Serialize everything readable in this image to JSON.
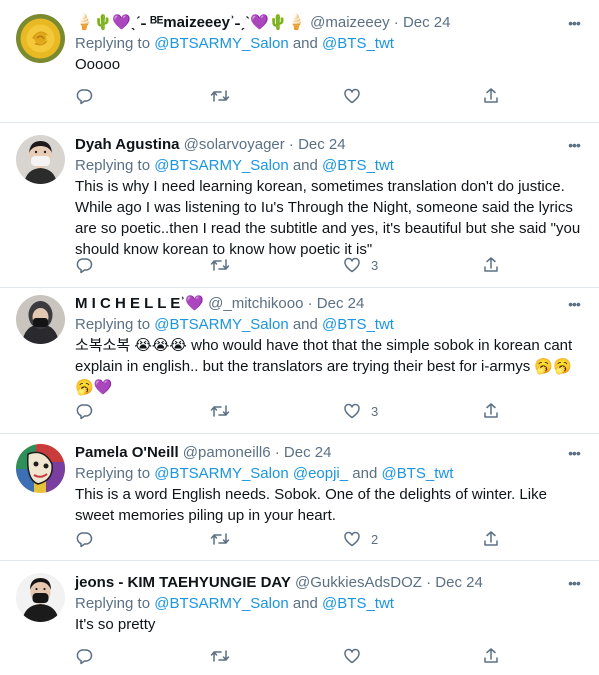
{
  "tweets": [
    {
      "name": "🍦🌵💜ˎˊ˗ ᴮᴱmaizeeeyʾ˗ˏˋ💜🌵🍦",
      "handle": "@maizeeey",
      "dot": "·",
      "date": "Dec 24",
      "replying_prefix": "Replying to",
      "mentions": [
        "@BTSARMY_Salon",
        "@BTS_twt"
      ],
      "joiner": "and",
      "text": "Ooooo",
      "reply_count": "",
      "retweet_count": "",
      "like_count": "",
      "avatar": "yellow-rose"
    },
    {
      "name": "Dyah Agustina",
      "handle": "@solarvoyager",
      "dot": "·",
      "date": "Dec 24",
      "replying_prefix": "Replying to",
      "mentions": [
        "@BTSARMY_Salon",
        "@BTS_twt"
      ],
      "joiner": "and",
      "text": "This is why I need learning korean, sometimes translation don't do justice. While ago I was listening to Iu's Through the Night, someone said the lyrics are so poetic..then I read the subtitle and yes, it's beautiful but she said \"you should know korean to know how poetic it is\"",
      "reply_count": "",
      "retweet_count": "",
      "like_count": "3",
      "avatar": "masked-woman"
    },
    {
      "name": "M I C H E L L Eʾ💜",
      "handle": "@_mitchikooo",
      "dot": "·",
      "date": "Dec 24",
      "replying_prefix": "Replying to",
      "mentions": [
        "@BTSARMY_Salon",
        "@BTS_twt"
      ],
      "joiner": "and",
      "text": "소복소복 😭😭😭  who would have thot that the simple sobok in korean cant explain in english.. but the translators are trying their best for i-armys 🥱🥱🥱💜",
      "reply_count": "",
      "retweet_count": "",
      "like_count": "3",
      "avatar": "masked-person"
    },
    {
      "name": "Pamela O'Neill",
      "handle": "@pamoneill6",
      "dot": "·",
      "date": "Dec 24",
      "replying_prefix": "Replying to",
      "mentions": [
        "@BTSARMY_Salon",
        "@eopji_",
        "@BTS_twt"
      ],
      "joiner": "and",
      "text": "This is a word English needs. Sobok. One of the delights of winter. Like sweet memories piling up in your heart.",
      "reply_count": "",
      "retweet_count": "",
      "like_count": "2",
      "avatar": "abstract-art"
    },
    {
      "name": "jeons - KIM TAEHYUNGIE DAY",
      "handle": "@GukkiesAdsDOZ",
      "dot": "·",
      "date": "Dec 24",
      "replying_prefix": "Replying to",
      "mentions": [
        "@BTSARMY_Salon",
        "@BTS_twt"
      ],
      "joiner": "and",
      "text": "It's so pretty",
      "reply_count": "",
      "retweet_count": "",
      "like_count": "",
      "avatar": "masked-man"
    }
  ],
  "colors": {
    "text": "#0f1419",
    "secondary": "#5b7083",
    "link": "#1b95e0",
    "divider": "#e1e8ed"
  },
  "icons": {
    "reply": "reply-icon",
    "retweet": "retweet-icon",
    "like": "like-icon",
    "share": "share-icon",
    "more": "more-icon"
  }
}
